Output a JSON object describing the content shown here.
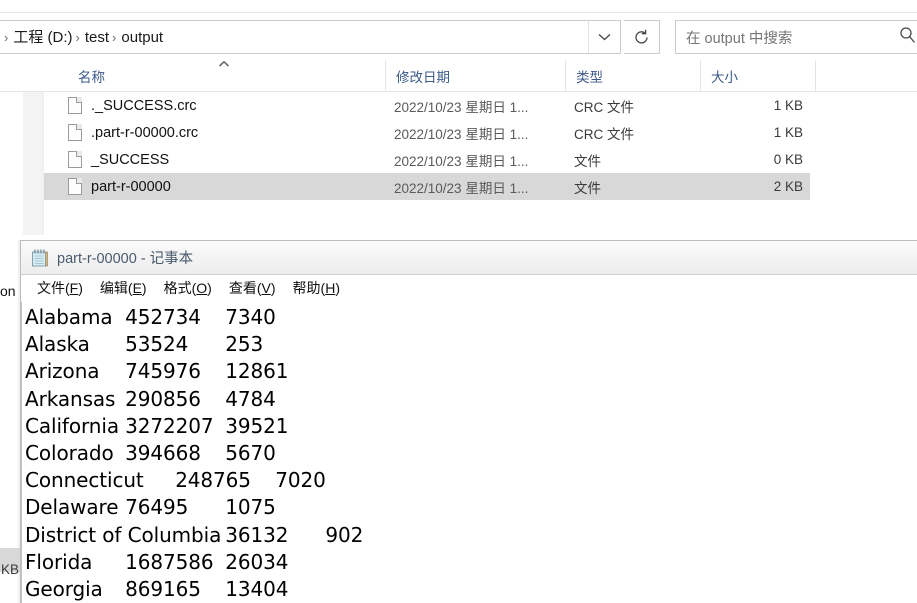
{
  "explorer": {
    "address": {
      "crumbs": [
        "工程 (D:)",
        "test",
        "output"
      ],
      "separator": "›",
      "dropdown_icon": "chevron-down-icon",
      "refresh_icon": "refresh-icon"
    },
    "search": {
      "placeholder": "在 output 中搜索",
      "icon": "search-icon"
    },
    "columns": [
      {
        "label": "名称",
        "key": "name"
      },
      {
        "label": "修改日期",
        "key": "date"
      },
      {
        "label": "类型",
        "key": "type"
      },
      {
        "label": "大小",
        "key": "size"
      }
    ],
    "sort_indicator": "^",
    "nav_collapse_icon": "chevron-up-icon",
    "files": [
      {
        "name": "._SUCCESS.crc",
        "date": "2022/10/23 星期日 1...",
        "type": "CRC 文件",
        "size": "1 KB",
        "selected": false
      },
      {
        "name": ".part-r-00000.crc",
        "date": "2022/10/23 星期日 1...",
        "type": "CRC 文件",
        "size": "1 KB",
        "selected": false
      },
      {
        "name": "_SUCCESS",
        "date": "2022/10/23 星期日 1...",
        "type": "文件",
        "size": "0 KB",
        "selected": false
      },
      {
        "name": "part-r-00000",
        "date": "2022/10/23 星期日 1...",
        "type": "文件",
        "size": "2 KB",
        "selected": true
      }
    ],
    "peek": {
      "left_text_fragment": "on",
      "left_size_fragment": "KB"
    }
  },
  "notepad": {
    "title": "part-r-00000 - 记事本",
    "icon": "notepad-icon",
    "menus": [
      {
        "label": "文件(F)",
        "pre": "文件(",
        "accel": "F",
        "post": ")"
      },
      {
        "label": "编辑(E)",
        "pre": "编辑(",
        "accel": "E",
        "post": ")"
      },
      {
        "label": "格式(O)",
        "pre": "格式(",
        "accel": "O",
        "post": ")"
      },
      {
        "label": "查看(V)",
        "pre": "查看(",
        "accel": "V",
        "post": ")"
      },
      {
        "label": "帮助(H)",
        "pre": "帮助(",
        "accel": "H",
        "post": ")"
      }
    ],
    "lines": [
      "Alabama\t452734\t7340",
      "Alaska\t53524\t253",
      "Arizona\t745976\t12861",
      "Arkansas\t290856\t4784",
      "California\t3272207\t39521",
      "Colorado\t394668\t5670",
      "Connecticut\t248765\t7020",
      "Delaware\t76495\t1075",
      "District of Columbia\t36132\t902",
      "Florida\t1687586\t26034",
      "Georgia\t869165\t13404"
    ],
    "records": [
      {
        "state": "Alabama",
        "value1": 452734,
        "value2": 7340
      },
      {
        "state": "Alaska",
        "value1": 53524,
        "value2": 253
      },
      {
        "state": "Arizona",
        "value1": 745976,
        "value2": 12861
      },
      {
        "state": "Arkansas",
        "value1": 290856,
        "value2": 4784
      },
      {
        "state": "California",
        "value1": 3272207,
        "value2": 39521
      },
      {
        "state": "Colorado",
        "value1": 394668,
        "value2": 5670
      },
      {
        "state": "Connecticut",
        "value1": 248765,
        "value2": 7020
      },
      {
        "state": "Delaware",
        "value1": 76495,
        "value2": 1075
      },
      {
        "state": "District of Columbia",
        "value1": 36132,
        "value2": 902
      },
      {
        "state": "Florida",
        "value1": 1687586,
        "value2": 26034
      },
      {
        "state": "Georgia",
        "value1": 869165,
        "value2": 13404
      }
    ]
  },
  "colors": {
    "selection": "#d8d8d8",
    "column_header_text": "#3c5a8a",
    "title_text": "#4a5b70",
    "placeholder": "#767676"
  }
}
